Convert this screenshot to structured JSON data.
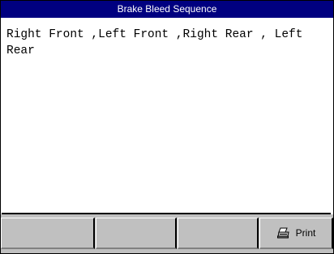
{
  "window": {
    "title": "Brake Bleed Sequence"
  },
  "content": {
    "text": "Right Front ,Left Front ,Right Rear , Left Rear"
  },
  "softkeys": [
    {
      "label": "",
      "icon": ""
    },
    {
      "label": "",
      "icon": ""
    },
    {
      "label": "",
      "icon": ""
    },
    {
      "label": "Print",
      "icon": "printer-icon"
    }
  ]
}
